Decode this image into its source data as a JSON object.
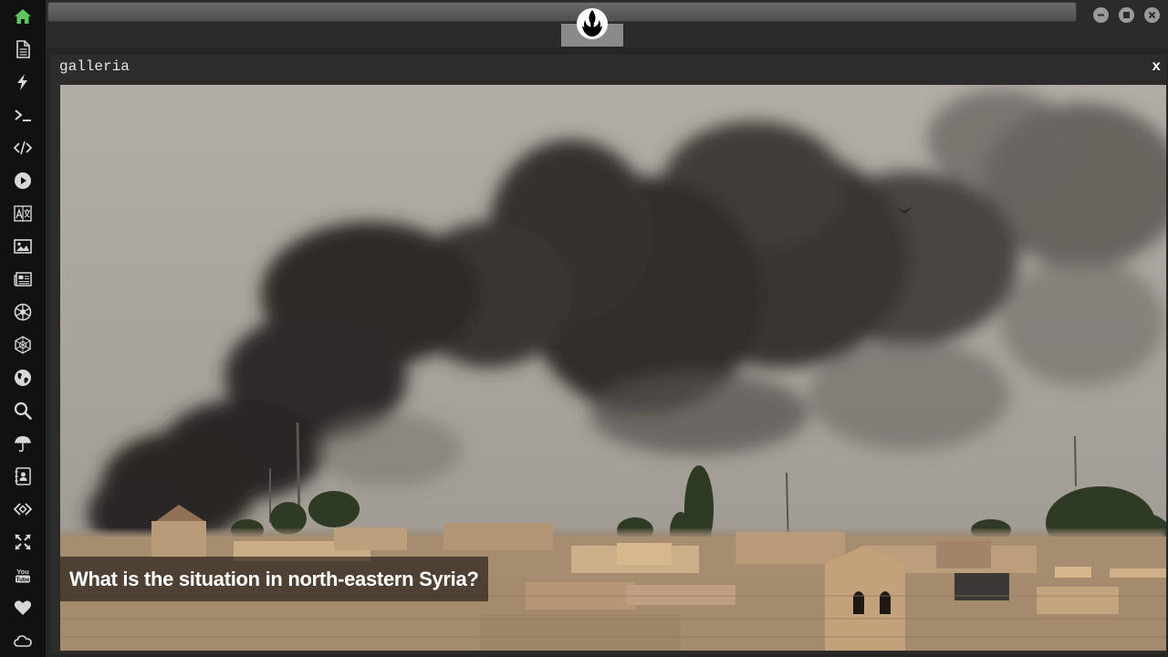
{
  "sidebar": {
    "items": [
      {
        "icon": "home-icon",
        "label": "Home"
      },
      {
        "icon": "document-icon",
        "label": "Document"
      },
      {
        "icon": "lightning-icon",
        "label": "Lightning"
      },
      {
        "icon": "terminal-icon",
        "label": "Terminal"
      },
      {
        "icon": "code-icon",
        "label": "Code"
      },
      {
        "icon": "play-icon",
        "label": "Play"
      },
      {
        "icon": "translate-icon",
        "label": "Translate"
      },
      {
        "icon": "image-icon",
        "label": "Image"
      },
      {
        "icon": "newspaper-icon",
        "label": "News"
      },
      {
        "icon": "aperture-icon",
        "label": "Aperture"
      },
      {
        "icon": "hexagon-icon",
        "label": "Hexagon"
      },
      {
        "icon": "globe-icon",
        "label": "Globe"
      },
      {
        "icon": "search-icon",
        "label": "Search"
      },
      {
        "icon": "umbrella-icon",
        "label": "Umbrella"
      },
      {
        "icon": "contacts-icon",
        "label": "Contacts"
      },
      {
        "icon": "embed-icon",
        "label": "Embed"
      },
      {
        "icon": "expand-icon",
        "label": "Expand"
      },
      {
        "icon": "youtube-icon",
        "label": "YouTube"
      },
      {
        "icon": "heart-icon",
        "label": "Heart"
      },
      {
        "icon": "cloud-icon",
        "label": "Cloud"
      }
    ],
    "active_color": "#5cc85c",
    "icon_color": "#d8d8d8"
  },
  "window": {
    "logo_icon": "rebel-alliance-icon",
    "controls": [
      "minimize-icon",
      "maximize-icon",
      "close-icon"
    ]
  },
  "panel": {
    "title": "galleria",
    "close_label": "x"
  },
  "gallery": {
    "caption": "What is the situation in north-eastern Syria?"
  }
}
